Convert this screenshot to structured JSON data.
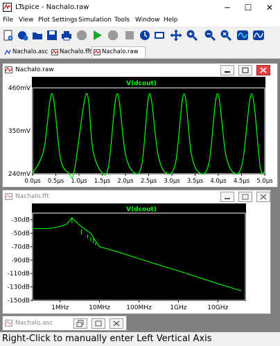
{
  "window": {
    "title": "LTspice - Nachalo.raw"
  },
  "menu": [
    "File",
    "View",
    "Plot Settings",
    "Simulation",
    "Tools",
    "Window",
    "Help"
  ],
  "toolbar": {
    "buttons": [
      "new-schematic-icon",
      "new-symbol-icon",
      "open-icon",
      "save-icon",
      "print-icon",
      "stop-icon",
      "run-icon",
      "halt-icon",
      "zoom-in-icon",
      "pan-icon",
      "zoom-out-icon",
      "zoom-fit-icon",
      "autorange-icon",
      "waveform-icon"
    ]
  },
  "tabs": [
    {
      "label": "Nachalo.asc",
      "active": false
    },
    {
      "label": "Nachalo.fft",
      "active": false
    },
    {
      "label": "Nachalo.raw",
      "active": true
    }
  ],
  "raw_window": {
    "title": "Nachalo.raw",
    "trace": "V(dcout)",
    "y_ticks": [
      "460mV",
      "350mV",
      "240mV"
    ],
    "x_ticks": [
      "0.0µs",
      "0.5µs",
      "1.0µs",
      "1.5µs",
      "2.0µs",
      "2.5µs",
      "3.0µs",
      "3.5µs",
      "4.0µs",
      "4.5µs",
      "5.0µs"
    ]
  },
  "fft_window": {
    "title": "Nachalo.fft",
    "trace": "V(dcout)",
    "y_ticks": [
      "-30dB",
      "-50dB",
      "-70dB",
      "-90dB",
      "-110dB",
      "-130dB",
      "-150dB"
    ],
    "x_ticks": [
      "1MHz",
      "10MHz",
      "100MHz",
      "1GHz",
      "10GHz"
    ]
  },
  "asc_window": {
    "title": "Nachalo.asc"
  },
  "status": "Right-Click to manually enter Left Vertical Axis",
  "colors": {
    "trace": "#00ff00",
    "plot_bg": "#000000",
    "grid": "#3a3a3a",
    "axis_text": "#000000"
  },
  "chart_data": [
    {
      "type": "line",
      "trace_name": "V(dcout)",
      "x_unit": "µs",
      "y_unit": "mV",
      "xlim": [
        0,
        5
      ],
      "ylim": [
        240,
        460
      ],
      "x": [
        0.0,
        0.24,
        0.42,
        0.6,
        0.78,
        0.9,
        1.16,
        1.3,
        1.5,
        1.64,
        1.82,
        2.0,
        2.2,
        2.36,
        2.52,
        2.7,
        2.88,
        3.08,
        3.26,
        3.42,
        3.6,
        3.8,
        3.98,
        4.16,
        4.34,
        4.52,
        4.72,
        4.9,
        5.0
      ],
      "y": [
        240,
        300,
        445,
        280,
        242,
        248,
        445,
        300,
        242,
        262,
        445,
        290,
        242,
        268,
        445,
        290,
        242,
        268,
        445,
        290,
        242,
        268,
        445,
        290,
        242,
        268,
        445,
        260,
        244
      ]
    },
    {
      "type": "line",
      "trace_name": "V(dcout)",
      "x_scale": "log",
      "x_unit": "Hz",
      "y_unit": "dB",
      "xlim": [
        200000,
        50000000000
      ],
      "ylim": [
        -150,
        -20
      ],
      "x": [
        200000,
        500000,
        1000000,
        1500000,
        2000000,
        3000000,
        4000000,
        6000000,
        8000000,
        10000000,
        30000000,
        100000000,
        1000000000,
        10000000000,
        40000000000
      ],
      "y": [
        -43,
        -43,
        -40,
        -36,
        -27,
        -37,
        -43,
        -50,
        -62,
        -70,
        -78,
        -88,
        -106,
        -125,
        -136
      ]
    }
  ]
}
